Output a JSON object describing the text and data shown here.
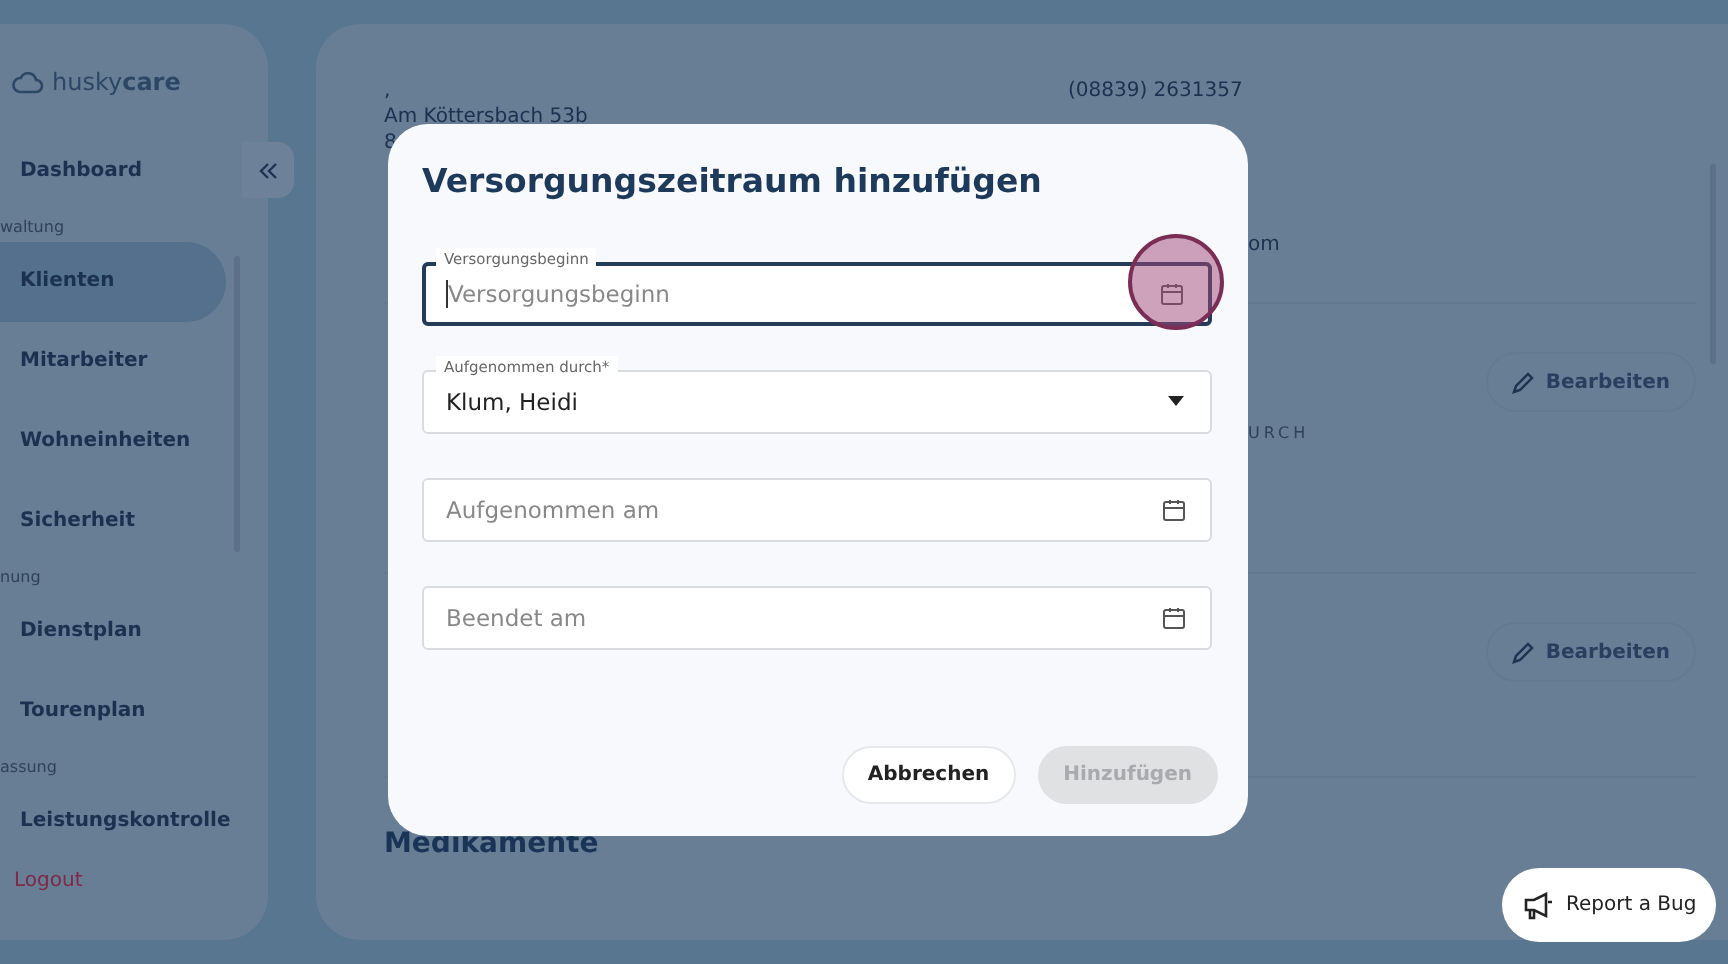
{
  "sidebar": {
    "logo": "husky",
    "logo_bold": "care",
    "items": [
      {
        "kind": "item",
        "label": "Dashboard",
        "selected": false
      },
      {
        "kind": "section",
        "label": "waltung"
      },
      {
        "kind": "item",
        "label": "Klienten",
        "selected": true
      },
      {
        "kind": "item",
        "label": "Mitarbeiter",
        "selected": false
      },
      {
        "kind": "item",
        "label": "Wohneinheiten",
        "selected": false
      },
      {
        "kind": "item",
        "label": "Sicherheit",
        "selected": false
      },
      {
        "kind": "section",
        "label": "nung"
      },
      {
        "kind": "item",
        "label": "Dienstplan",
        "selected": false
      },
      {
        "kind": "item",
        "label": "Tourenplan",
        "selected": false
      },
      {
        "kind": "section",
        "label": "assung"
      },
      {
        "kind": "item",
        "label": "Leistungskontrolle",
        "selected": false
      }
    ],
    "logout": "Logout"
  },
  "client": {
    "address_lines": [
      ",",
      "Am Köttersbach 53b",
      "8"
    ],
    "phone": "(08839) 2631357",
    "email_fragment": "om",
    "column_fragment": "URCH",
    "edit_buttons": [
      "Bearbeiten",
      "Bearbeiten"
    ],
    "section_title": "Medikamente"
  },
  "dialog": {
    "title": "Versorgungszeitraum hinzufügen",
    "fields": [
      {
        "kind": "date",
        "label": "Versorgungsbeginn",
        "placeholder": "Versorgungsbeginn",
        "focused": true
      },
      {
        "kind": "select",
        "label": "Aufgenommen durch*",
        "value": "Klum, Heidi",
        "focused": false
      },
      {
        "kind": "date",
        "placeholder": "Aufgenommen am",
        "focused": false
      },
      {
        "kind": "date",
        "placeholder": "Beendet am",
        "focused": false
      }
    ],
    "buttons": [
      {
        "label": "Abbrechen",
        "disabled": false
      },
      {
        "label": "Hinzufügen",
        "disabled": true
      }
    ]
  },
  "report_button": "Report a Bug"
}
